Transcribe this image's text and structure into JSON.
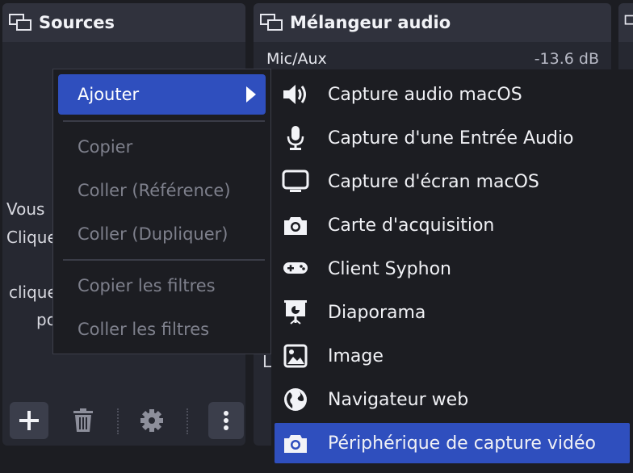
{
  "sources": {
    "title": "Sources",
    "empty_lines": [
      "Vous",
      "Clique",
      "clique",
      "po"
    ]
  },
  "mixer": {
    "title": "Mélangeur audio",
    "channel_name": "Mic/Aux",
    "channel_db": "-13.6 dB",
    "partial_label": "L"
  },
  "context_menu": {
    "add": "Ajouter",
    "copy": "Copier",
    "paste_ref": "Coller (Référence)",
    "paste_dup": "Coller (Dupliquer)",
    "copy_filters": "Copier les filtres",
    "paste_filters": "Coller les filtres"
  },
  "submenu": [
    {
      "label": "Capture audio macOS",
      "icon": "speaker-icon"
    },
    {
      "label": "Capture d'une Entrée Audio",
      "icon": "microphone-icon"
    },
    {
      "label": "Capture d'écran macOS",
      "icon": "monitor-icon"
    },
    {
      "label": "Carte d'acquisition",
      "icon": "camera-icon"
    },
    {
      "label": "Client Syphon",
      "icon": "gamepad-icon"
    },
    {
      "label": "Diaporama",
      "icon": "slideshow-icon"
    },
    {
      "label": "Image",
      "icon": "image-icon"
    },
    {
      "label": "Navigateur web",
      "icon": "globe-icon"
    },
    {
      "label": "Périphérique de capture vidéo",
      "icon": "camera-icon"
    }
  ],
  "colors": {
    "accent": "#2f4fbe",
    "dock_bg": "#262831",
    "header_bg": "#30323d",
    "menu_bg": "#1c1d22",
    "disabled_text": "#7e808c"
  }
}
